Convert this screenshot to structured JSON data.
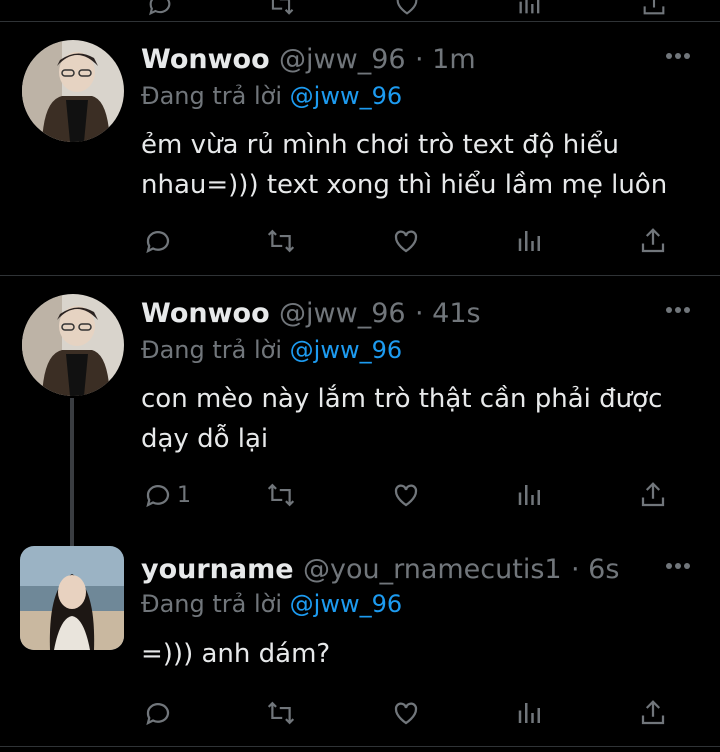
{
  "tweets": [
    {
      "name": "Wonwoo",
      "handle": "@jww_96",
      "time": "· 1m",
      "reply_prefix": "Đang trả lời",
      "reply_to": "@jww_96",
      "text": "ẻm vừa rủ mình chơi trò text độ hiểu nhau=))) text xong thì hiểu lầm mẹ luôn",
      "reply_count": ""
    },
    {
      "name": "Wonwoo",
      "handle": "@jww_96",
      "time": "· 41s",
      "reply_prefix": "Đang trả lời",
      "reply_to": "@jww_96",
      "text": "con mèo này lắm trò thật cần phải được dạy dỗ lại",
      "reply_count": "1"
    },
    {
      "name": "yourname",
      "handle": "@you_rnamecutis1",
      "time": "· 6s",
      "reply_prefix": "Đang trả lời",
      "reply_to": "@jww_96",
      "text": "=))) anh dám?",
      "reply_count": ""
    }
  ],
  "icons": {
    "more": "more-horizontal-icon",
    "reply": "reply-bubble-icon",
    "retweet": "retweet-icon",
    "like": "heart-icon",
    "views": "analytics-icon",
    "share": "share-icon"
  },
  "colors": {
    "background": "#000000",
    "text": "#e7e9ea",
    "muted": "#71767b",
    "mention": "#1d9bf0",
    "divider": "#2f3336"
  }
}
